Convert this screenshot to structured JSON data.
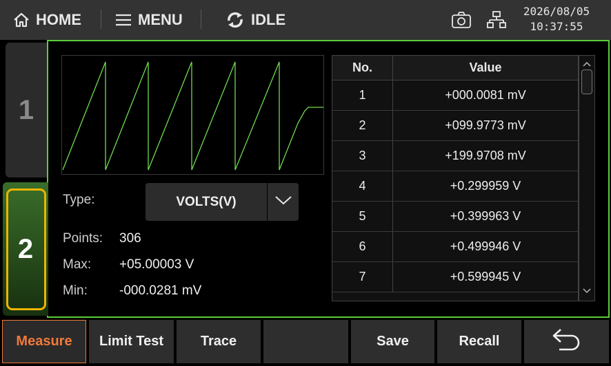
{
  "topbar": {
    "home_label": "HOME",
    "menu_label": "MENU",
    "status_label": "IDLE",
    "date": "2026/08/05",
    "time": "10:37:55"
  },
  "tabs": [
    {
      "label": "1"
    },
    {
      "label": "2"
    }
  ],
  "panel": {
    "type_label": "Type:",
    "type_value": "VOLTS(V)",
    "points_label": "Points:",
    "points_value": "306",
    "max_label": "Max:",
    "max_value": "+05.00003 V",
    "min_label": "Min:",
    "min_value": "-000.0281 mV"
  },
  "table": {
    "col_no": "No.",
    "col_value": "Value",
    "rows": [
      {
        "no": "1",
        "value": "+000.0081 mV"
      },
      {
        "no": "2",
        "value": "+099.9773 mV"
      },
      {
        "no": "3",
        "value": "+199.9708 mV"
      },
      {
        "no": "4",
        "value": "+0.299959 V"
      },
      {
        "no": "5",
        "value": "+0.399963 V"
      },
      {
        "no": "6",
        "value": "+0.499946 V"
      },
      {
        "no": "7",
        "value": "+0.599945 V"
      }
    ]
  },
  "bottombar": {
    "measure": "Measure",
    "limit_test": "Limit Test",
    "trace": "Trace",
    "empty": "",
    "save": "Save",
    "recall": "Recall"
  },
  "colors": {
    "accent_green": "#5ccc3c",
    "active_orange": "#f07a3a",
    "tab_highlight": "#f0b400",
    "trace_green": "#6fdc4f"
  },
  "icons": {
    "home": "home-icon",
    "menu": "menu-icon",
    "status": "refresh-icon",
    "camera": "camera-icon",
    "network": "network-icon",
    "dropdown": "chevron-down-icon",
    "back": "back-arrow-icon"
  }
}
